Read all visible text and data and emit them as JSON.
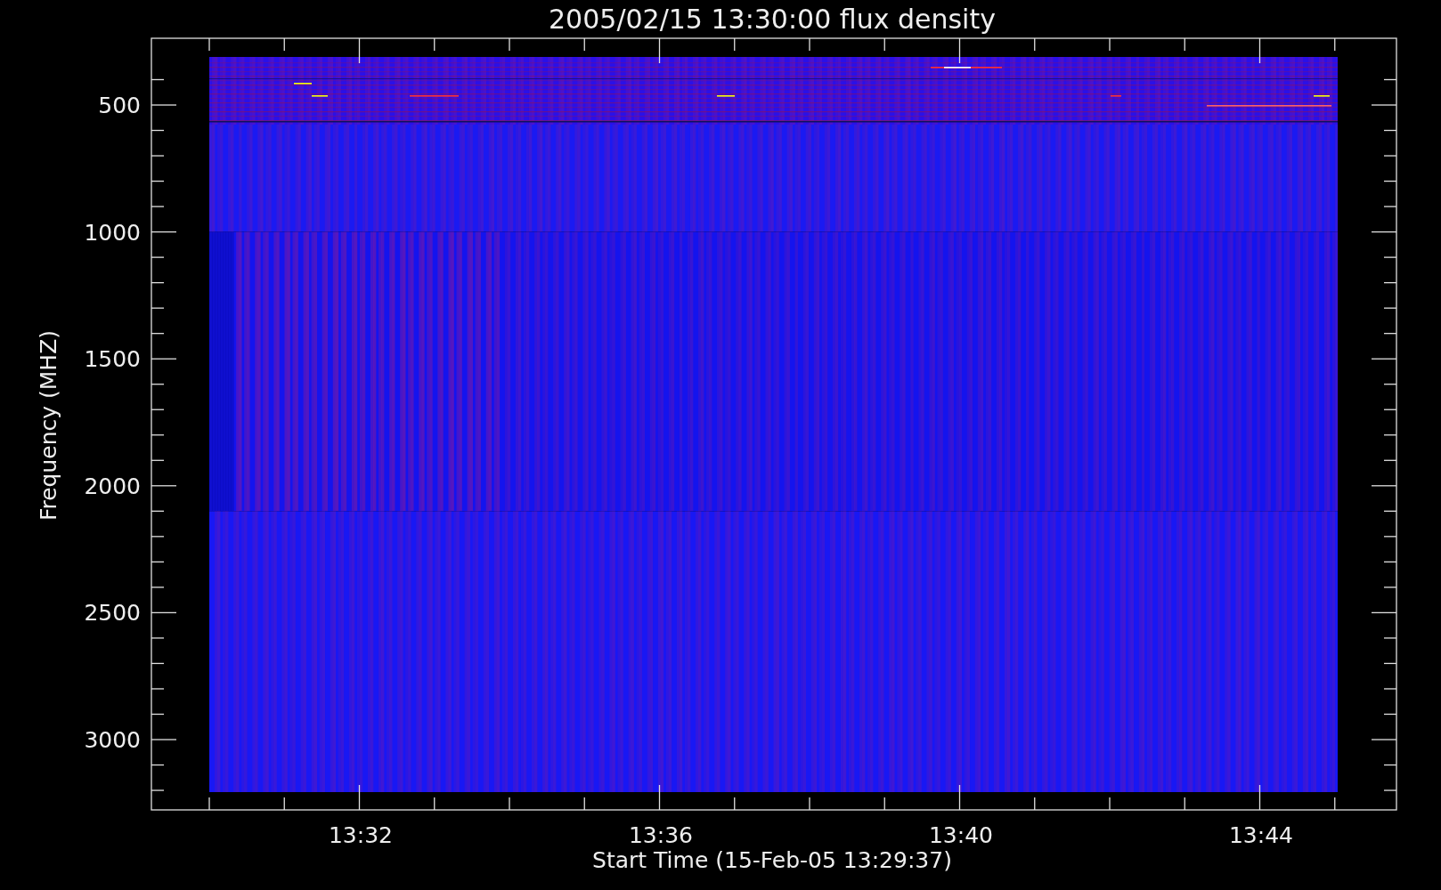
{
  "plot": {
    "title": "2005/02/15 13:30:00 flux density",
    "xlabel": "Start Time (15-Feb-05 13:29:37)",
    "ylabel": "Frequency (MHZ)",
    "xticks": [
      "13:32",
      "13:36",
      "13:40",
      "13:44"
    ],
    "yticks": [
      "500",
      "1000",
      "1500",
      "2000",
      "2500",
      "3000"
    ]
  }
}
